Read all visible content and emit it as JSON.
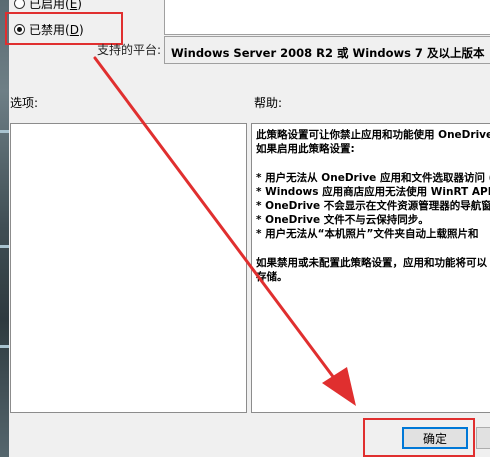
{
  "state": {
    "enabled_label": "已启用(",
    "enabled_key": "E",
    "disabled_label": "已禁用(",
    "disabled_key": "D",
    "close_paren": ")",
    "selected": "disabled"
  },
  "platform": {
    "label": "支持的平台:",
    "value": "Windows Server 2008 R2 或 Windows 7 及以上版本"
  },
  "sections": {
    "options_label": "选项:",
    "help_label": "帮助:"
  },
  "help_text": [
    "此策略设置可让你禁止应用和功能使用 OneDrive",
    "如果启用此策略设置:",
    "",
    "* 用户无法从 OneDrive 应用和文件选取器访问 (",
    "* Windows 应用商店应用无法使用 WinRT API",
    "* OneDrive 不会显示在文件资源管理器的导航窗",
    "* OneDrive 文件不与云保持同步。",
    "* 用户无法从“本机照片”文件夹自动上载照片和",
    "",
    "如果禁用或未配置此策略设置，应用和功能将可以",
    "存储。"
  ],
  "buttons": {
    "ok_label": "确定"
  },
  "annotation": {
    "color": "#e02f2f"
  }
}
